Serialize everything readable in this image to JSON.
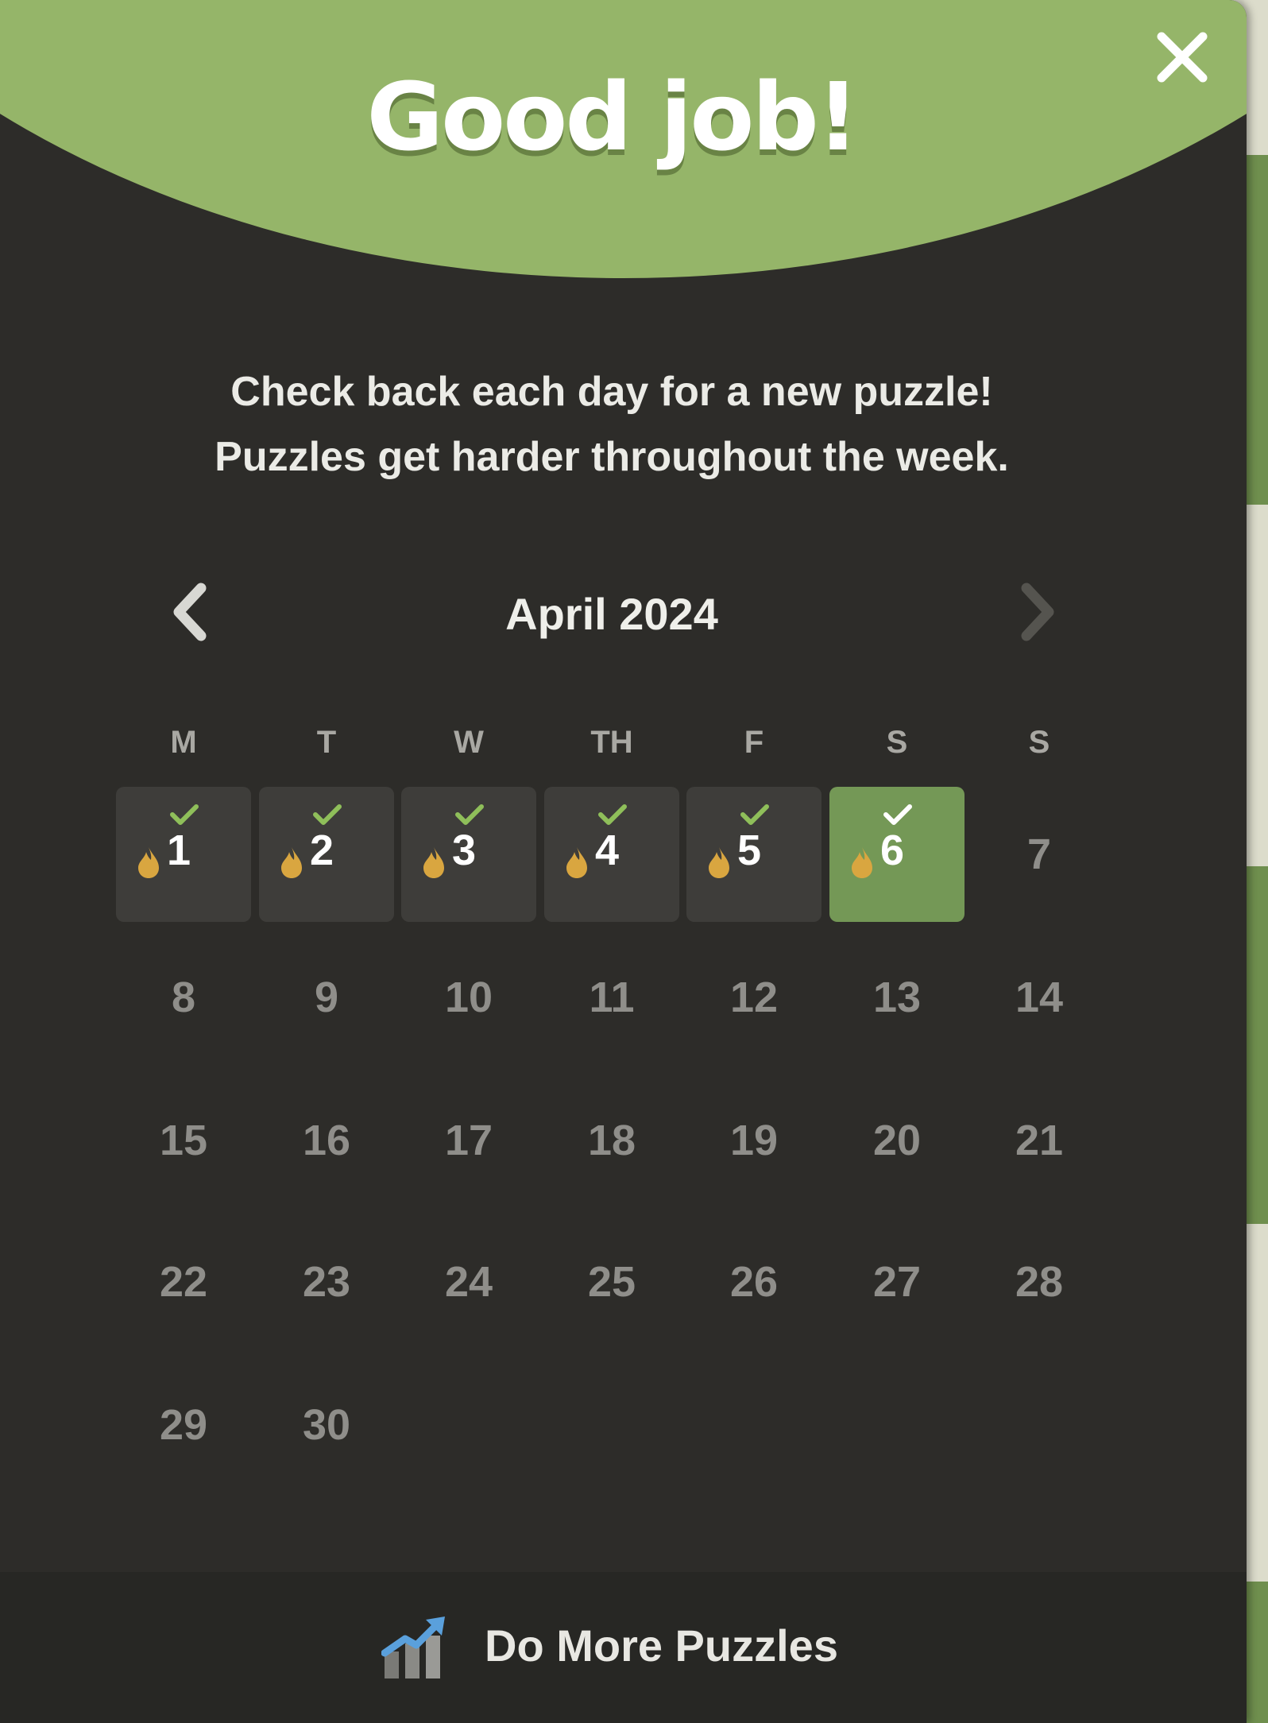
{
  "header": {
    "title": "Good job!"
  },
  "message": {
    "line1": "Check back each day for a new puzzle!",
    "line2": "Puzzles get harder throughout the week."
  },
  "calendar": {
    "month_label": "April 2024",
    "weekdays": [
      "M",
      "T",
      "W",
      "TH",
      "F",
      "S",
      "S"
    ],
    "days": [
      {
        "n": "1",
        "status": "played"
      },
      {
        "n": "2",
        "status": "played"
      },
      {
        "n": "3",
        "status": "played"
      },
      {
        "n": "4",
        "status": "played"
      },
      {
        "n": "5",
        "status": "played"
      },
      {
        "n": "6",
        "status": "today"
      },
      {
        "n": "7",
        "status": "future"
      },
      {
        "n": "8",
        "status": "future"
      },
      {
        "n": "9",
        "status": "future"
      },
      {
        "n": "10",
        "status": "future"
      },
      {
        "n": "11",
        "status": "future"
      },
      {
        "n": "12",
        "status": "future"
      },
      {
        "n": "13",
        "status": "future"
      },
      {
        "n": "14",
        "status": "future"
      },
      {
        "n": "15",
        "status": "future"
      },
      {
        "n": "16",
        "status": "future"
      },
      {
        "n": "17",
        "status": "future"
      },
      {
        "n": "18",
        "status": "future"
      },
      {
        "n": "19",
        "status": "future"
      },
      {
        "n": "20",
        "status": "future"
      },
      {
        "n": "21",
        "status": "future"
      },
      {
        "n": "22",
        "status": "future"
      },
      {
        "n": "23",
        "status": "future"
      },
      {
        "n": "24",
        "status": "future"
      },
      {
        "n": "25",
        "status": "future"
      },
      {
        "n": "26",
        "status": "future"
      },
      {
        "n": "27",
        "status": "future"
      },
      {
        "n": "28",
        "status": "future"
      },
      {
        "n": "29",
        "status": "future"
      },
      {
        "n": "30",
        "status": "future"
      }
    ]
  },
  "footer": {
    "button_label": "Do More Puzzles",
    "icon": "chart-arrow-icon"
  },
  "colors": {
    "header_green": "#95b569",
    "today_green": "#749856",
    "check_green": "#8fbf5a",
    "flame": "#d9a640",
    "panel": "#2d2c29"
  },
  "icons": [
    "close-icon",
    "chevron-left-icon",
    "chevron-right-icon",
    "check-icon",
    "flame-icon",
    "chart-arrow-icon"
  ]
}
